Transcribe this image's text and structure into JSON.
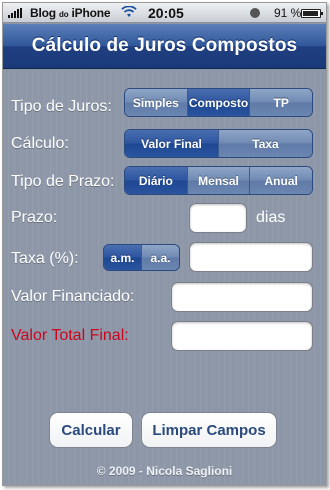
{
  "status_bar": {
    "carrier": "Blog",
    "carrier_small": "do",
    "device": "iPhone",
    "time": "20:05",
    "battery_text": "91 %",
    "battery_level": 0.91
  },
  "nav": {
    "title": "Cálculo de Juros Compostos"
  },
  "form": {
    "tipo_juros": {
      "label": "Tipo de Juros:",
      "options": [
        "Simples",
        "Composto",
        "TP"
      ],
      "selected": 1
    },
    "calculo": {
      "label": "Cálculo:",
      "options": [
        "Valor Final",
        "Taxa"
      ],
      "selected": 0
    },
    "tipo_prazo": {
      "label": "Tipo de Prazo:",
      "options": [
        "Diário",
        "Mensal",
        "Anual"
      ],
      "selected": 0
    },
    "prazo": {
      "label": "Prazo:",
      "value": "",
      "unit": "dias"
    },
    "taxa": {
      "label": "Taxa (%):",
      "options": [
        "a.m.",
        "a.a."
      ],
      "selected": 0,
      "value": ""
    },
    "valor_financiado": {
      "label": "Valor Financiado:",
      "value": ""
    },
    "valor_total_final": {
      "label": "Valor Total Final:",
      "value": ""
    }
  },
  "buttons": {
    "calcular": "Calcular",
    "limpar": "Limpar Campos"
  },
  "footer": {
    "text": "© 2009 - Nicola Saglioni"
  },
  "colors": {
    "nav_blue": "#2f5799",
    "background": "#8d97a8",
    "segment_selected": "#2c55a0",
    "segment_normal": "#6f89b3",
    "result_label_red": "#c8071e",
    "button_text": "#2a4a7d"
  }
}
